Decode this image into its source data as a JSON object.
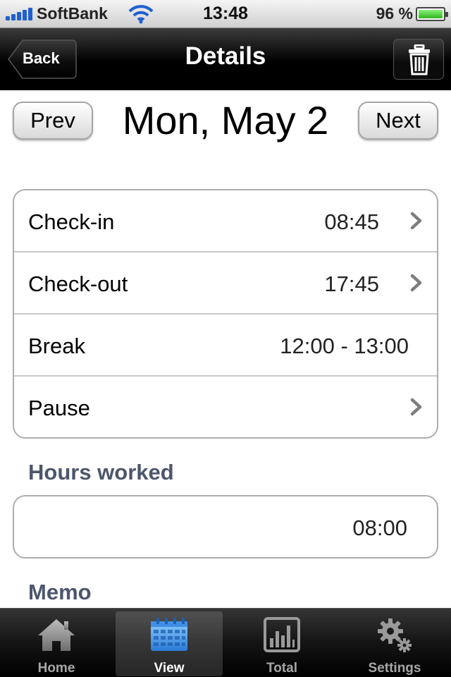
{
  "status_bar": {
    "carrier": "SoftBank",
    "time": "13:48",
    "battery_percent": "96 %",
    "battery_level": 0.96,
    "icons": [
      "signal-icon",
      "wifi-icon",
      "battery-icon"
    ]
  },
  "nav": {
    "title": "Details",
    "back_label": "Back",
    "trash_icon": "trash-icon"
  },
  "date_nav": {
    "prev_label": "Prev",
    "date": "Mon, May 2",
    "next_label": "Next"
  },
  "times": [
    {
      "label": "Check-in",
      "value": "08:45",
      "chevron": true
    },
    {
      "label": "Check-out",
      "value": "17:45",
      "chevron": true
    },
    {
      "label": "Break",
      "value": "12:00 - 13:00",
      "chevron": false
    },
    {
      "label": "Pause",
      "value": "",
      "chevron": true
    }
  ],
  "hours_worked": {
    "label": "Hours worked",
    "value": "08:00"
  },
  "memo": {
    "label": "Memo"
  },
  "tabs": [
    {
      "label": "Home",
      "icon": "home-icon",
      "selected": false
    },
    {
      "label": "View",
      "icon": "calendar-icon",
      "selected": true
    },
    {
      "label": "Total",
      "icon": "bar-chart-icon",
      "selected": false
    },
    {
      "label": "Settings",
      "icon": "gear-icon",
      "selected": false
    }
  ],
  "colors": {
    "section_label": "#4c566c",
    "selected_tab_icon": "#4a9be8",
    "battery_fill": "#2db51f"
  }
}
